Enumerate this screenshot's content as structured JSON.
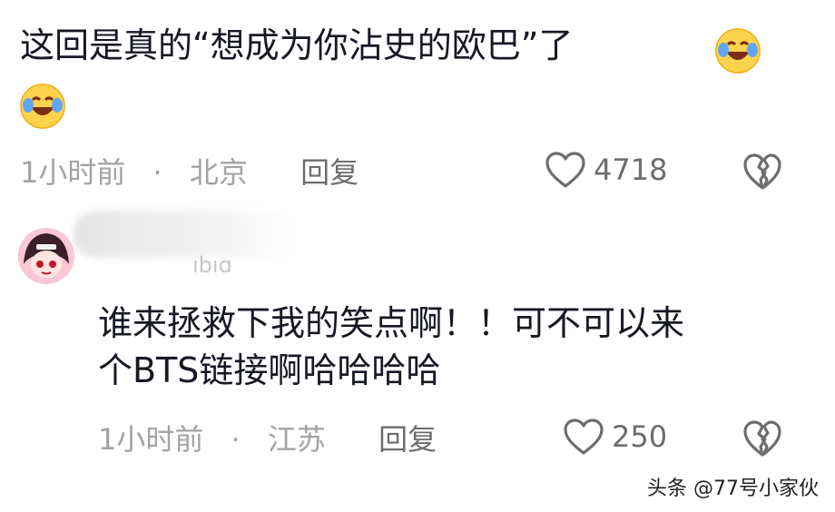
{
  "top_cut_text": "",
  "comment1": {
    "text_line1": "这回是真的“想成为你沾史的欧巴”了",
    "time": "1小时前",
    "location": "北京",
    "reply_label": "回复",
    "like_count": "4718"
  },
  "comment2": {
    "username_partial": "ıbıɑ",
    "text_line1": "谁来拯救下我的笑点啊！！可不可以来",
    "text_line2": "个BTS链接啊哈哈哈哈",
    "time": "1小时前",
    "location": "江苏",
    "reply_label": "回复",
    "like_count": "250"
  },
  "separator": "·",
  "watermark": "头条 @77号小家伙",
  "icons": {
    "like": "heart-outline-icon",
    "dislike": "broken-heart-icon",
    "emoji": "rolling-laughing-emoji-icon"
  },
  "colors": {
    "text": "#161823",
    "meta": "#a3a3a3"
  }
}
